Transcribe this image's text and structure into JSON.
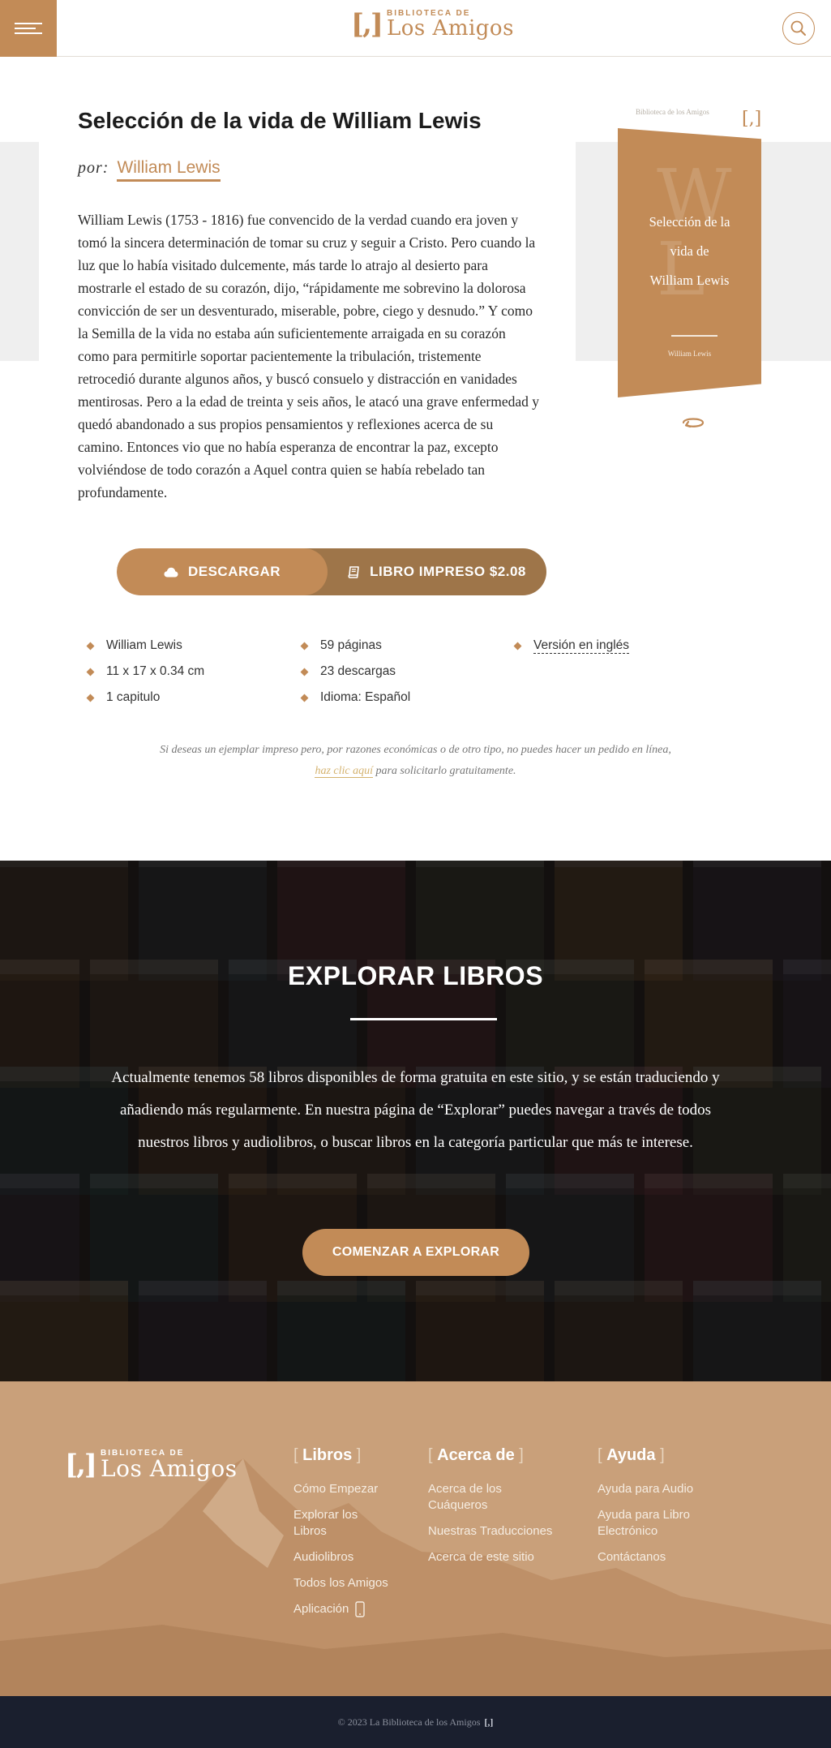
{
  "header": {
    "logo_small": "BIBLIOTECA DE",
    "logo_big": "Los Amigos",
    "logo_mark": "[,]"
  },
  "book": {
    "title": "Selección de la vida de William Lewis",
    "por_label": "por:",
    "author": "William Lewis",
    "description": "William Lewis (1753 - 1816) fue convencido de la verdad cuando era joven y tomó la sincera determinación de tomar su cruz y seguir a Cristo. Pero cuando la luz que lo había visitado dulcemente, más tarde lo atrajo al desierto para mostrarle el estado de su corazón, dijo, “rápidamente me sobrevino la dolorosa convicción de ser un desventurado, miserable, pobre, ciego y desnudo.” Y como la Semilla de la vida no estaba aún suficientemente arraigada en su corazón como para permitirle soportar pacientemente la tribulación, tristemente retrocedió durante algunos años, y buscó consuelo y distracción en vanidades mentirosas. Pero a la edad de treinta y seis años, le atacó una grave enfermedad y quedó abandonado a sus propios pensamientos y reflexiones acerca de su camino. Entonces vio que no había esperanza de encontrar la paz, excepto volviéndose de todo corazón a Aquel contra quien se había rebelado tan profundamente."
  },
  "cover": {
    "small_text": "Biblioteca de los Amigos",
    "mark": "[,]",
    "letter1": "W",
    "letter2": "L",
    "title_line1": "Selección de la",
    "title_line2": "vida de",
    "title_line3": "William Lewis",
    "author": "William Lewis"
  },
  "actions": {
    "download_label": "DESCARGAR",
    "print_label": "LIBRO IMPRESO $2.08"
  },
  "details": {
    "col1": [
      "William Lewis",
      "11 x 17 x 0.34 cm",
      "1 capitulo"
    ],
    "col2": [
      "59 páginas",
      "23 descargas",
      "Idioma: Español"
    ],
    "col3": [
      "Versión en inglés"
    ]
  },
  "note": {
    "line1": "Si deseas un ejemplar impreso pero, por razones económicas o de otro tipo, no puedes hacer un pedido en línea,",
    "link": "haz clic aquí",
    "line2_rest": " para solicitarlo gratuitamente."
  },
  "explore": {
    "title": "EXPLORAR LIBROS",
    "text": "Actualmente tenemos 58 libros disponibles de forma gratuita en este sitio, y se están traduciendo y añadiendo más regularmente. En nuestra página de “Explorar” puedes navegar a través de todos nuestros libros y audiolibros, o buscar libros en la categoría particular que más te interese.",
    "button": "COMENZAR A EXPLORAR"
  },
  "footer": {
    "logo_small": "BIBLIOTECA DE",
    "logo_big": "Los Amigos",
    "columns": [
      {
        "heading": "Libros",
        "links": [
          "Cómo Empezar",
          "Explorar los Libros",
          "Audiolibros",
          "Todos los Amigos",
          "Aplicación"
        ]
      },
      {
        "heading": "Acerca de",
        "links": [
          "Acerca de los Cuáqueros",
          "Nuestras Traducciones",
          "Acerca de este sitio"
        ]
      },
      {
        "heading": "Ayuda",
        "links": [
          "Ayuda para Audio",
          "Ayuda para Libro Electrónico",
          "Contáctanos"
        ]
      }
    ],
    "copyright": "© 2023 La Biblioteca de los Amigos",
    "copyright_mark": "[,]"
  },
  "colors": {
    "accent": "#c28b57",
    "accent_dark": "#9e7549",
    "footer_bg": "#c9a07a",
    "bottom_bar": "#1a1f2e"
  }
}
